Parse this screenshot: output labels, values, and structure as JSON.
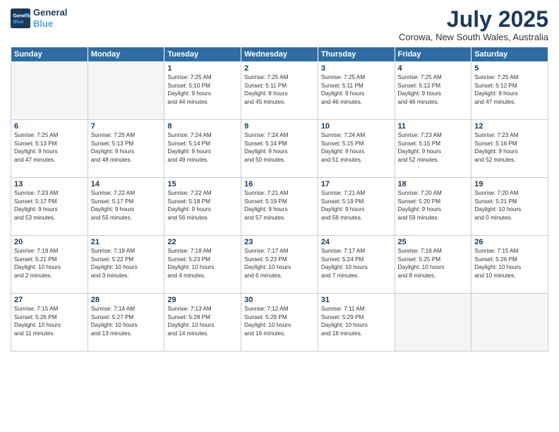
{
  "header": {
    "logo_line1": "General",
    "logo_line2": "Blue",
    "month_title": "July 2025",
    "subtitle": "Corowa, New South Wales, Australia"
  },
  "weekdays": [
    "Sunday",
    "Monday",
    "Tuesday",
    "Wednesday",
    "Thursday",
    "Friday",
    "Saturday"
  ],
  "weeks": [
    [
      {
        "day": "",
        "info": ""
      },
      {
        "day": "",
        "info": ""
      },
      {
        "day": "1",
        "info": "Sunrise: 7:25 AM\nSunset: 5:10 PM\nDaylight: 9 hours\nand 44 minutes."
      },
      {
        "day": "2",
        "info": "Sunrise: 7:25 AM\nSunset: 5:11 PM\nDaylight: 9 hours\nand 45 minutes."
      },
      {
        "day": "3",
        "info": "Sunrise: 7:25 AM\nSunset: 5:11 PM\nDaylight: 9 hours\nand 46 minutes."
      },
      {
        "day": "4",
        "info": "Sunrise: 7:25 AM\nSunset: 5:12 PM\nDaylight: 9 hours\nand 46 minutes."
      },
      {
        "day": "5",
        "info": "Sunrise: 7:25 AM\nSunset: 5:12 PM\nDaylight: 9 hours\nand 47 minutes."
      }
    ],
    [
      {
        "day": "6",
        "info": "Sunrise: 7:25 AM\nSunset: 5:13 PM\nDaylight: 9 hours\nand 47 minutes."
      },
      {
        "day": "7",
        "info": "Sunrise: 7:25 AM\nSunset: 5:13 PM\nDaylight: 9 hours\nand 48 minutes."
      },
      {
        "day": "8",
        "info": "Sunrise: 7:24 AM\nSunset: 5:14 PM\nDaylight: 9 hours\nand 49 minutes."
      },
      {
        "day": "9",
        "info": "Sunrise: 7:24 AM\nSunset: 5:14 PM\nDaylight: 9 hours\nand 50 minutes."
      },
      {
        "day": "10",
        "info": "Sunrise: 7:24 AM\nSunset: 5:15 PM\nDaylight: 9 hours\nand 51 minutes."
      },
      {
        "day": "11",
        "info": "Sunrise: 7:23 AM\nSunset: 5:15 PM\nDaylight: 9 hours\nand 52 minutes."
      },
      {
        "day": "12",
        "info": "Sunrise: 7:23 AM\nSunset: 5:16 PM\nDaylight: 9 hours\nand 52 minutes."
      }
    ],
    [
      {
        "day": "13",
        "info": "Sunrise: 7:23 AM\nSunset: 5:17 PM\nDaylight: 9 hours\nand 53 minutes."
      },
      {
        "day": "14",
        "info": "Sunrise: 7:22 AM\nSunset: 5:17 PM\nDaylight: 9 hours\nand 55 minutes."
      },
      {
        "day": "15",
        "info": "Sunrise: 7:22 AM\nSunset: 5:18 PM\nDaylight: 9 hours\nand 56 minutes."
      },
      {
        "day": "16",
        "info": "Sunrise: 7:21 AM\nSunset: 5:19 PM\nDaylight: 9 hours\nand 57 minutes."
      },
      {
        "day": "17",
        "info": "Sunrise: 7:21 AM\nSunset: 5:19 PM\nDaylight: 9 hours\nand 58 minutes."
      },
      {
        "day": "18",
        "info": "Sunrise: 7:20 AM\nSunset: 5:20 PM\nDaylight: 9 hours\nand 59 minutes."
      },
      {
        "day": "19",
        "info": "Sunrise: 7:20 AM\nSunset: 5:21 PM\nDaylight: 10 hours\nand 0 minutes."
      }
    ],
    [
      {
        "day": "20",
        "info": "Sunrise: 7:19 AM\nSunset: 5:21 PM\nDaylight: 10 hours\nand 2 minutes."
      },
      {
        "day": "21",
        "info": "Sunrise: 7:19 AM\nSunset: 5:22 PM\nDaylight: 10 hours\nand 3 minutes."
      },
      {
        "day": "22",
        "info": "Sunrise: 7:18 AM\nSunset: 5:23 PM\nDaylight: 10 hours\nand 4 minutes."
      },
      {
        "day": "23",
        "info": "Sunrise: 7:17 AM\nSunset: 5:23 PM\nDaylight: 10 hours\nand 6 minutes."
      },
      {
        "day": "24",
        "info": "Sunrise: 7:17 AM\nSunset: 5:24 PM\nDaylight: 10 hours\nand 7 minutes."
      },
      {
        "day": "25",
        "info": "Sunrise: 7:16 AM\nSunset: 5:25 PM\nDaylight: 10 hours\nand 8 minutes."
      },
      {
        "day": "26",
        "info": "Sunrise: 7:15 AM\nSunset: 5:26 PM\nDaylight: 10 hours\nand 10 minutes."
      }
    ],
    [
      {
        "day": "27",
        "info": "Sunrise: 7:15 AM\nSunset: 5:26 PM\nDaylight: 10 hours\nand 11 minutes."
      },
      {
        "day": "28",
        "info": "Sunrise: 7:14 AM\nSunset: 5:27 PM\nDaylight: 10 hours\nand 13 minutes."
      },
      {
        "day": "29",
        "info": "Sunrise: 7:13 AM\nSunset: 5:28 PM\nDaylight: 10 hours\nand 14 minutes."
      },
      {
        "day": "30",
        "info": "Sunrise: 7:12 AM\nSunset: 5:29 PM\nDaylight: 10 hours\nand 16 minutes."
      },
      {
        "day": "31",
        "info": "Sunrise: 7:11 AM\nSunset: 5:29 PM\nDaylight: 10 hours\nand 18 minutes."
      },
      {
        "day": "",
        "info": ""
      },
      {
        "day": "",
        "info": ""
      }
    ]
  ]
}
